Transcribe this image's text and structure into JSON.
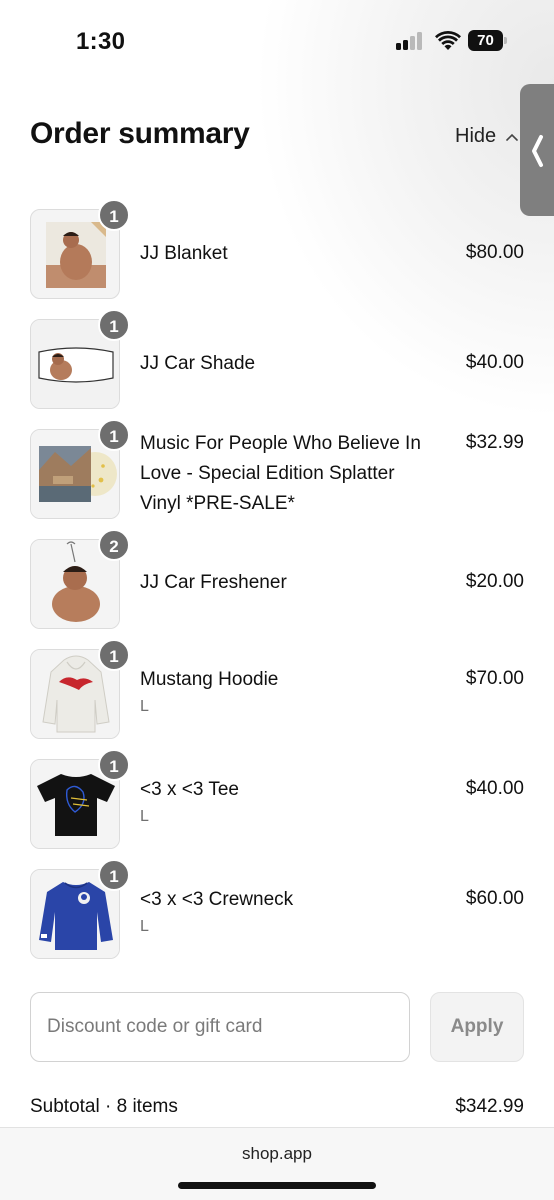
{
  "status_bar": {
    "time": "1:30",
    "battery": "70"
  },
  "header": {
    "title": "Order summary",
    "toggle_label": "Hide"
  },
  "items": [
    {
      "name": "JJ Blanket",
      "price": "$80.00",
      "quantity": "1",
      "variant": "",
      "icon": "blanket-photo"
    },
    {
      "name": "JJ Car Shade",
      "price": "$40.00",
      "quantity": "1",
      "variant": "",
      "icon": "car-shade-photo"
    },
    {
      "name": "Music For People Who Believe In Love - Special Edition Splatter Vinyl *PRE-SALE*",
      "price": "$32.99",
      "quantity": "1",
      "variant": "",
      "icon": "vinyl-record-photo"
    },
    {
      "name": "JJ Car Freshener",
      "price": "$20.00",
      "quantity": "2",
      "variant": "",
      "icon": "car-freshener-photo"
    },
    {
      "name": "Mustang Hoodie",
      "price": "$70.00",
      "quantity": "1",
      "variant": "L",
      "icon": "hoodie-photo"
    },
    {
      "name": "<3 x <3 Tee",
      "price": "$40.00",
      "quantity": "1",
      "variant": "L",
      "icon": "tshirt-photo"
    },
    {
      "name": "<3 x <3 Crewneck",
      "price": "$60.00",
      "quantity": "1",
      "variant": "L",
      "icon": "crewneck-photo"
    }
  ],
  "discount": {
    "placeholder": "Discount code or gift card",
    "apply_label": "Apply"
  },
  "subtotal": {
    "label": "Subtotal · 8 items",
    "value": "$342.99"
  },
  "browser": {
    "url": "shop.app"
  },
  "colors": {
    "badge": "#6e6e6e",
    "side_handle": "#7f7f7f",
    "hoodie": "#ecebe6",
    "crewneck": "#2a45a8"
  }
}
